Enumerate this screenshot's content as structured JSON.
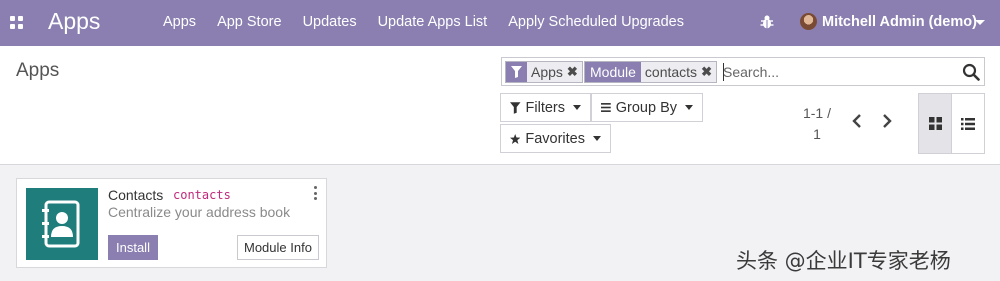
{
  "navbar": {
    "brand": "Apps",
    "menu": [
      "Apps",
      "App Store",
      "Updates",
      "Update Apps List",
      "Apply Scheduled Upgrades"
    ],
    "user": "Mitchell Admin (demo)",
    "icons": [
      "apps-grid-icon",
      "bug-icon",
      "avatar"
    ],
    "color": "#8a7fb0"
  },
  "control_panel": {
    "title": "Apps",
    "search": {
      "facets": [
        {
          "key": "",
          "key_icon": "filter-icon",
          "value": "Apps"
        },
        {
          "key": "Module",
          "value": "contacts"
        }
      ],
      "placeholder": "Search..."
    },
    "buttons": {
      "filters": "Filters",
      "group_by": "Group By",
      "favorites": "Favorites"
    },
    "pager": {
      "line1": "1-1 /",
      "line2": "1"
    },
    "views": [
      "kanban",
      "list"
    ],
    "active_view": "kanban"
  },
  "modules": [
    {
      "name": "Contacts",
      "technical_name": "contacts",
      "summary": "Centralize your address book",
      "install_label": "Install",
      "info_label": "Module Info",
      "icon": "contacts-book-icon",
      "icon_color": "#1f7d7c"
    }
  ],
  "watermark": "头条 @企业IT专家老杨"
}
